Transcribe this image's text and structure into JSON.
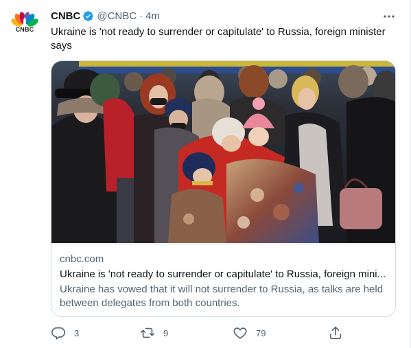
{
  "author": {
    "name": "CNBC",
    "handle": "@CNBC",
    "separator": "·",
    "time": "4m",
    "avatar_text": "CNBC",
    "avatar_icon": "nbc-peacock-icon",
    "verified_icon": "verified-badge-icon",
    "verified_color": "#1d9bf0"
  },
  "tweet": {
    "text": "Ukraine is 'not ready to surrender or capitulate' to Russia, foreign minister says"
  },
  "card": {
    "domain": "cnbc.com",
    "title": "Ukraine is 'not ready to surrender or capitulate' to Russia, foreign mini...",
    "description": "Ukraine has vowed that it will not surrender to Russia, as talks are held between delegates from both countries."
  },
  "actions": {
    "replies": "3",
    "retweets": "9",
    "likes": "79"
  },
  "colors": {
    "text_primary": "#0f1419",
    "text_secondary": "#536471",
    "border": "#cfd9de"
  }
}
